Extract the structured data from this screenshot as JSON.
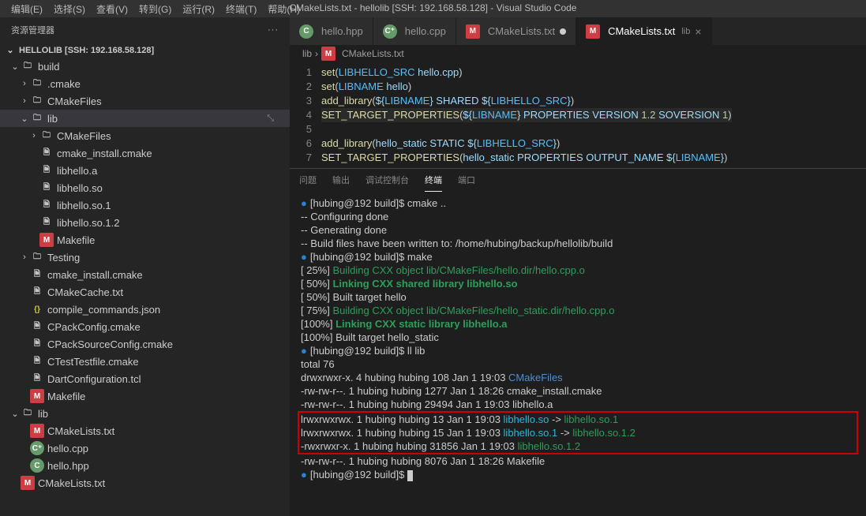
{
  "window": {
    "title": "CMakeLists.txt - hellolib [SSH: 192.168.58.128] - Visual Studio Code"
  },
  "menubar": [
    "编辑(E)",
    "选择(S)",
    "查看(V)",
    "转到(G)",
    "运行(R)",
    "终端(T)",
    "帮助(H)"
  ],
  "sidebar": {
    "title": "资源管理器",
    "section": "HELLOLIB [SSH: 192.168.58.128]",
    "items": [
      {
        "indent": 1,
        "chev": "v",
        "icon": "folder",
        "label": "build"
      },
      {
        "indent": 2,
        "chev": ">",
        "icon": "folder",
        "label": ".cmake"
      },
      {
        "indent": 2,
        "chev": ">",
        "icon": "folder",
        "label": "CMakeFiles"
      },
      {
        "indent": 2,
        "chev": "v",
        "icon": "folder",
        "label": "lib",
        "active": true,
        "collapse": true
      },
      {
        "indent": 3,
        "chev": ">",
        "icon": "folder",
        "label": "CMakeFiles"
      },
      {
        "indent": 3,
        "icon": "file",
        "label": "cmake_install.cmake"
      },
      {
        "indent": 3,
        "icon": "file",
        "label": "libhello.a"
      },
      {
        "indent": 3,
        "icon": "file",
        "label": "libhello.so"
      },
      {
        "indent": 3,
        "icon": "file",
        "label": "libhello.so.1"
      },
      {
        "indent": 3,
        "icon": "file",
        "label": "libhello.so.1.2"
      },
      {
        "indent": 3,
        "icon": "M",
        "label": "Makefile"
      },
      {
        "indent": 2,
        "chev": ">",
        "icon": "folder",
        "label": "Testing"
      },
      {
        "indent": 2,
        "icon": "file",
        "label": "cmake_install.cmake"
      },
      {
        "indent": 2,
        "icon": "file",
        "label": "CMakeCache.txt"
      },
      {
        "indent": 2,
        "icon": "json",
        "label": "compile_commands.json"
      },
      {
        "indent": 2,
        "icon": "file",
        "label": "CPackConfig.cmake"
      },
      {
        "indent": 2,
        "icon": "file",
        "label": "CPackSourceConfig.cmake"
      },
      {
        "indent": 2,
        "icon": "file",
        "label": "CTestTestfile.cmake"
      },
      {
        "indent": 2,
        "icon": "file",
        "label": "DartConfiguration.tcl"
      },
      {
        "indent": 2,
        "icon": "M",
        "label": "Makefile"
      },
      {
        "indent": 1,
        "chev": "v",
        "icon": "folder",
        "label": "lib"
      },
      {
        "indent": 2,
        "icon": "M",
        "label": "CMakeLists.txt"
      },
      {
        "indent": 2,
        "icon": "Cpp",
        "label": "hello.cpp"
      },
      {
        "indent": 2,
        "icon": "C",
        "label": "hello.hpp"
      },
      {
        "indent": 1,
        "icon": "M",
        "label": "CMakeLists.txt"
      }
    ]
  },
  "tabs": [
    {
      "icon": "C",
      "label": "hello.hpp",
      "active": false
    },
    {
      "icon": "Cpp",
      "label": "hello.cpp",
      "active": false
    },
    {
      "icon": "M",
      "label": "CMakeLists.txt",
      "active": false,
      "dirty": true
    },
    {
      "icon": "M",
      "label": "CMakeLists.txt",
      "folder": "lib",
      "active": true,
      "close": true
    }
  ],
  "breadcrumbs": {
    "a": "lib",
    "b": "CMakeLists.txt"
  },
  "code": {
    "lines": [
      [
        {
          "c": "fn",
          "t": "set"
        },
        {
          "t": "("
        },
        {
          "c": "const",
          "t": "LIBHELLO_SRC"
        },
        {
          "t": " "
        },
        {
          "c": "var",
          "t": "hello.cpp"
        },
        {
          "t": ")"
        }
      ],
      [
        {
          "c": "fn",
          "t": "set"
        },
        {
          "t": "("
        },
        {
          "c": "const",
          "t": "LIBNAME"
        },
        {
          "t": " "
        },
        {
          "c": "var",
          "t": "hello"
        },
        {
          "t": ")"
        }
      ],
      [
        {
          "c": "fn",
          "t": "add_library"
        },
        {
          "t": "("
        },
        {
          "c": "var",
          "t": "${"
        },
        {
          "c": "const",
          "t": "LIBNAME"
        },
        {
          "c": "var",
          "t": "}"
        },
        {
          "t": " "
        },
        {
          "c": "var",
          "t": "SHARED"
        },
        {
          "t": " "
        },
        {
          "c": "var",
          "t": "${"
        },
        {
          "c": "const",
          "t": "LIBHELLO_SRC"
        },
        {
          "c": "var",
          "t": "}"
        },
        {
          "t": ")"
        }
      ],
      [
        {
          "c": "fn",
          "t": "SET_TARGET_PROPERTIES"
        },
        {
          "t": "("
        },
        {
          "c": "var",
          "t": "${"
        },
        {
          "c": "const",
          "t": "LIBNAME"
        },
        {
          "c": "var",
          "t": "}"
        },
        {
          "t": " "
        },
        {
          "c": "var",
          "t": "PROPERTIES"
        },
        {
          "t": " "
        },
        {
          "c": "var",
          "t": "VERSION"
        },
        {
          "t": " "
        },
        {
          "c": "num",
          "t": "1.2"
        },
        {
          "t": " "
        },
        {
          "c": "var",
          "t": "SOVERSION"
        },
        {
          "t": " "
        },
        {
          "c": "num",
          "t": "1"
        },
        {
          "t": ")"
        }
      ],
      [],
      [
        {
          "c": "fn",
          "t": "add_library"
        },
        {
          "t": "("
        },
        {
          "c": "var",
          "t": "hello_static"
        },
        {
          "t": " "
        },
        {
          "c": "var",
          "t": "STATIC"
        },
        {
          "t": " "
        },
        {
          "c": "var",
          "t": "${"
        },
        {
          "c": "const",
          "t": "LIBHELLO_SRC"
        },
        {
          "c": "var",
          "t": "}"
        },
        {
          "t": ")"
        }
      ],
      [
        {
          "c": "fn",
          "t": "SET_TARGET_PROPERTIES"
        },
        {
          "t": "("
        },
        {
          "c": "var",
          "t": "hello_static"
        },
        {
          "t": " "
        },
        {
          "c": "var",
          "t": "PROPERTIES"
        },
        {
          "t": " "
        },
        {
          "c": "var",
          "t": "OUTPUT_NAME"
        },
        {
          "t": " "
        },
        {
          "c": "var",
          "t": "${"
        },
        {
          "c": "const",
          "t": "LIBNAME"
        },
        {
          "c": "var",
          "t": "}"
        },
        {
          "t": ")"
        }
      ]
    ],
    "highlight": 4
  },
  "panel": {
    "tabs": [
      "问题",
      "输出",
      "调试控制台",
      "终端",
      "端口"
    ],
    "active": 3
  },
  "terminal": {
    "lines": [
      {
        "bullet": true,
        "segs": [
          {
            "t": "[hubing@192 build]$ cmake .."
          }
        ]
      },
      {
        "segs": [
          {
            "t": "-- Configuring done"
          }
        ]
      },
      {
        "segs": [
          {
            "t": "-- Generating done"
          }
        ]
      },
      {
        "segs": [
          {
            "t": "-- Build files have been written to: /home/hubing/backup/hellolib/build"
          }
        ]
      },
      {
        "bullet": true,
        "segs": [
          {
            "t": "[hubing@192 build]$ make"
          }
        ]
      },
      {
        "segs": [
          {
            "t": "[ 25%] "
          },
          {
            "c": "green",
            "t": "Building CXX object lib/CMakeFiles/hello.dir/hello.cpp.o"
          }
        ]
      },
      {
        "segs": [
          {
            "t": "[ 50%] "
          },
          {
            "c": "tealb",
            "t": "Linking CXX shared library libhello.so"
          }
        ]
      },
      {
        "segs": [
          {
            "t": "[ 50%] Built target hello"
          }
        ]
      },
      {
        "segs": [
          {
            "t": "[ 75%] "
          },
          {
            "c": "green",
            "t": "Building CXX object lib/CMakeFiles/hello_static.dir/hello.cpp.o"
          }
        ]
      },
      {
        "segs": [
          {
            "t": "[100%] "
          },
          {
            "c": "tealb",
            "t": "Linking CXX static library libhello.a"
          }
        ]
      },
      {
        "segs": [
          {
            "t": "[100%] Built target hello_static"
          }
        ]
      },
      {
        "bullet": true,
        "segs": [
          {
            "t": "[hubing@192 build]$ ll lib"
          }
        ]
      },
      {
        "segs": [
          {
            "t": "total 76"
          }
        ]
      },
      {
        "segs": [
          {
            "t": "drwxrwxr-x. 4 hubing hubing   108 Jan  1 19:03 "
          },
          {
            "c": "blue",
            "t": "CMakeFiles"
          }
        ]
      },
      {
        "segs": [
          {
            "t": "-rw-rw-r--. 1 hubing hubing  1277 Jan  1 18:26 cmake_install.cmake"
          }
        ]
      },
      {
        "segs": [
          {
            "t": "-rw-rw-r--. 1 hubing hubing 29494 Jan  1 19:03 libhello.a"
          }
        ]
      }
    ],
    "redbox": [
      {
        "segs": [
          {
            "t": "lrwxrwxrwx. 1 hubing hubing    13 Jan  1 19:03 "
          },
          {
            "c": "cyan",
            "t": "libhello.so"
          },
          {
            "t": " -> "
          },
          {
            "c": "green",
            "t": "libhello.so.1"
          }
        ]
      },
      {
        "segs": [
          {
            "t": "lrwxrwxrwx. 1 hubing hubing    15 Jan  1 19:03 "
          },
          {
            "c": "cyan",
            "t": "libhello.so.1"
          },
          {
            "t": " -> "
          },
          {
            "c": "green",
            "t": "libhello.so.1.2"
          }
        ]
      },
      {
        "segs": [
          {
            "t": "-rwxrwxr-x. 1 hubing hubing 31856 Jan  1 19:03 "
          },
          {
            "c": "green",
            "t": "libhello.so.1.2"
          }
        ]
      }
    ],
    "after": [
      {
        "segs": [
          {
            "t": "-rw-rw-r--. 1 hubing hubing  8076 Jan  1 18:26 Makefile"
          }
        ]
      },
      {
        "bullet": true,
        "cursor": true,
        "segs": [
          {
            "t": "[hubing@192 build]$ "
          }
        ]
      }
    ]
  }
}
